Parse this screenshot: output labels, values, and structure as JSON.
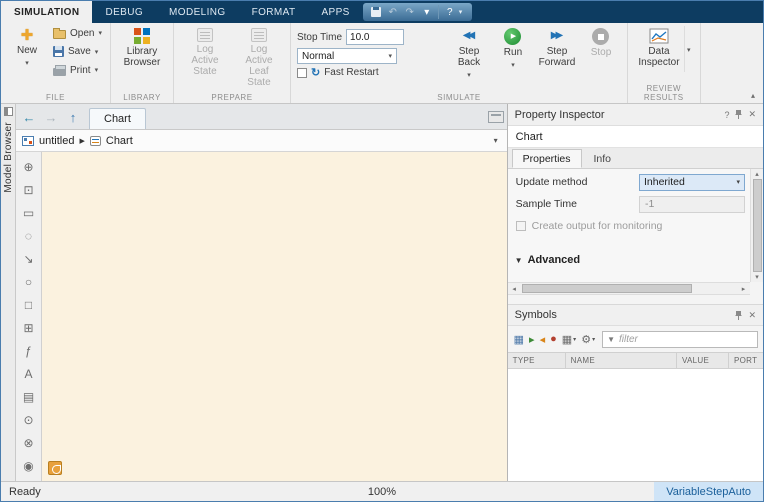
{
  "titlebar": {
    "tabs": [
      {
        "label": "SIMULATION"
      },
      {
        "label": "DEBUG"
      },
      {
        "label": "MODELING"
      },
      {
        "label": "FORMAT"
      },
      {
        "label": "APPS"
      }
    ]
  },
  "glyphs": {
    "caret": "▾",
    "undo": "↶",
    "redo": "↷",
    "help": "?",
    "close": "✕",
    "collapse": "▴",
    "back": "←",
    "forward": "→",
    "up": "↑",
    "separator": "▶",
    "play": "▶",
    "step_back": "◀◀",
    "step_forward": "▶▶",
    "restart": "↻",
    "plus": "✚",
    "advanced_caret": "▼",
    "funnel": "▼",
    "scroll_left": "◂",
    "scroll_right": "▸",
    "scroll_up": "▴",
    "scroll_down": "▾"
  },
  "colors": {
    "titlebar_blue": "#0d3c61",
    "run_green": "#1d8c33",
    "canvas_cream": "#fbf2df",
    "solver_badge_bg": "#cfe4f7",
    "solver_badge_text": "#1a5f9a"
  },
  "ribbon": {
    "file": {
      "section_label": "FILE",
      "new_label": "New",
      "open_label": "Open",
      "save_label": "Save",
      "print_label": "Print"
    },
    "library": {
      "section_label": "LIBRARY",
      "library_browser_label": "Library Browser"
    },
    "prepare": {
      "section_label": "PREPARE",
      "log_active_state_label": "Log Active State",
      "log_active_leaf_state_label": "Log Active Leaf State"
    },
    "simulate": {
      "section_label": "SIMULATE",
      "stop_time_label": "Stop Time",
      "stop_time_value": "10.0",
      "mode_value": "Normal",
      "fast_restart_label": "Fast Restart",
      "step_back_label": "Step Back",
      "run_label": "Run",
      "step_forward_label": "Step Forward",
      "stop_label": "Stop"
    },
    "review": {
      "section_label": "REVIEW RESULTS",
      "data_inspector_label": "Data Inspector"
    }
  },
  "sidebar": {
    "model_browser_label": "Model Browser"
  },
  "palette": {
    "items": [
      {
        "glyph": "⊕"
      },
      {
        "glyph": "⊡"
      },
      {
        "glyph": "▭"
      },
      {
        "glyph": "◌"
      },
      {
        "glyph": "↘"
      },
      {
        "glyph": "○"
      },
      {
        "glyph": "□"
      },
      {
        "glyph": "⊞"
      },
      {
        "glyph": "ƒ"
      },
      {
        "glyph": "A"
      },
      {
        "glyph": "▤"
      },
      {
        "glyph": "⊙"
      },
      {
        "glyph": "⊗"
      },
      {
        "glyph": "◉"
      }
    ]
  },
  "editor": {
    "doc_tab": "Chart",
    "breadcrumb": {
      "model": "untitled",
      "chart": "Chart"
    }
  },
  "inspector": {
    "title": "Property Inspector",
    "object_name": "Chart",
    "tabs": [
      {
        "label": "Properties"
      },
      {
        "label": "Info"
      }
    ],
    "fields": {
      "update_method_label": "Update method",
      "update_method_value": "Inherited",
      "sample_time_label": "Sample Time",
      "sample_time_value": "-1",
      "monitor_checkbox_label": "Create output for monitoring"
    },
    "advanced_label": "Advanced"
  },
  "symbols": {
    "title": "Symbols",
    "buttons": [
      {
        "glyph": "▦"
      },
      {
        "glyph": "▸"
      },
      {
        "glyph": "◂"
      },
      {
        "glyph": "●"
      },
      {
        "glyph": "▦"
      },
      {
        "glyph": "⚙"
      }
    ],
    "filter_placeholder": "filter",
    "columns": [
      "TYPE",
      "NAME",
      "VALUE",
      "PORT"
    ]
  },
  "statusbar": {
    "ready": "Ready",
    "zoom": "100%",
    "solver": "VariableStepAuto"
  }
}
